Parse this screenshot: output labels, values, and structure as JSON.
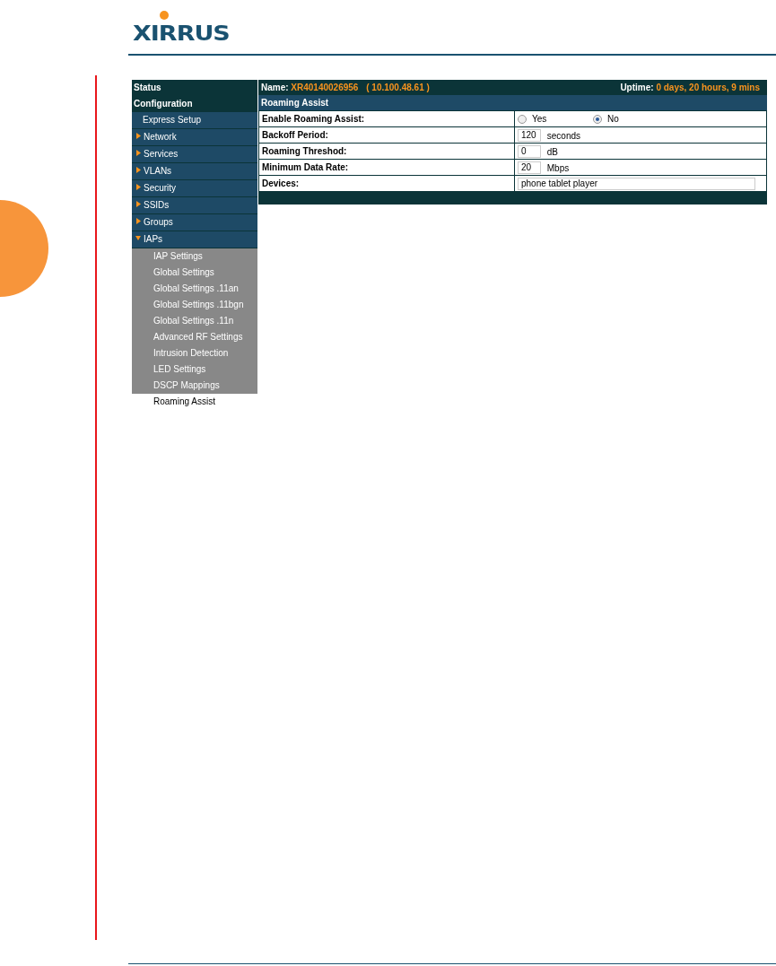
{
  "logo": {
    "text": "XIRRUS"
  },
  "sidebar": {
    "items": [
      {
        "label": "Status",
        "kind": "header",
        "selected": false
      },
      {
        "label": "Configuration",
        "kind": "header",
        "selected": false
      },
      {
        "label": "Express Setup",
        "kind": "link",
        "selected": false
      },
      {
        "label": "Network",
        "kind": "group",
        "expanded": false,
        "selected": false
      },
      {
        "label": "Services",
        "kind": "group",
        "expanded": false,
        "selected": false
      },
      {
        "label": "VLANs",
        "kind": "group",
        "expanded": false,
        "selected": false
      },
      {
        "label": "Security",
        "kind": "group",
        "expanded": false,
        "selected": false
      },
      {
        "label": "SSIDs",
        "kind": "group",
        "expanded": false,
        "selected": false
      },
      {
        "label": "Groups",
        "kind": "group",
        "expanded": false,
        "selected": false
      },
      {
        "label": "IAPs",
        "kind": "group",
        "expanded": true,
        "selected": false
      },
      {
        "label": "IAP Settings",
        "kind": "sub",
        "selected": false
      },
      {
        "label": "Global Settings",
        "kind": "sub",
        "selected": false
      },
      {
        "label": "Global Settings .11an",
        "kind": "sub",
        "selected": false
      },
      {
        "label": "Global Settings .11bgn",
        "kind": "sub",
        "selected": false
      },
      {
        "label": "Global Settings .11n",
        "kind": "sub",
        "selected": false
      },
      {
        "label": "Advanced RF Settings",
        "kind": "sub",
        "selected": false
      },
      {
        "label": "Intrusion Detection",
        "kind": "sub",
        "selected": false
      },
      {
        "label": "LED Settings",
        "kind": "sub",
        "selected": false
      },
      {
        "label": "DSCP Mappings",
        "kind": "sub",
        "selected": false
      },
      {
        "label": "Roaming Assist",
        "kind": "sub",
        "selected": true
      }
    ]
  },
  "panel": {
    "name_label": "Name:",
    "name_value": "XR40140026956",
    "ip": "( 10.100.48.61 )",
    "uptime_label": "Uptime:",
    "uptime_value": "0 days, 20 hours, 9 mins",
    "section_title": "Roaming Assist",
    "rows": [
      {
        "label": "Enable Roaming Assist:",
        "kind": "radio",
        "options": [
          {
            "label": "Yes",
            "selected": false
          },
          {
            "label": "No",
            "selected": true
          }
        ]
      },
      {
        "label": "Backoff Period:",
        "kind": "number",
        "value": "120",
        "unit": "seconds"
      },
      {
        "label": "Roaming Threshod:",
        "kind": "number",
        "value": "0",
        "unit": "dB"
      },
      {
        "label": "Minimum Data Rate:",
        "kind": "number",
        "value": "20",
        "unit": "Mbps"
      },
      {
        "label": "Devices:",
        "kind": "text",
        "value": "phone tablet player"
      }
    ]
  }
}
